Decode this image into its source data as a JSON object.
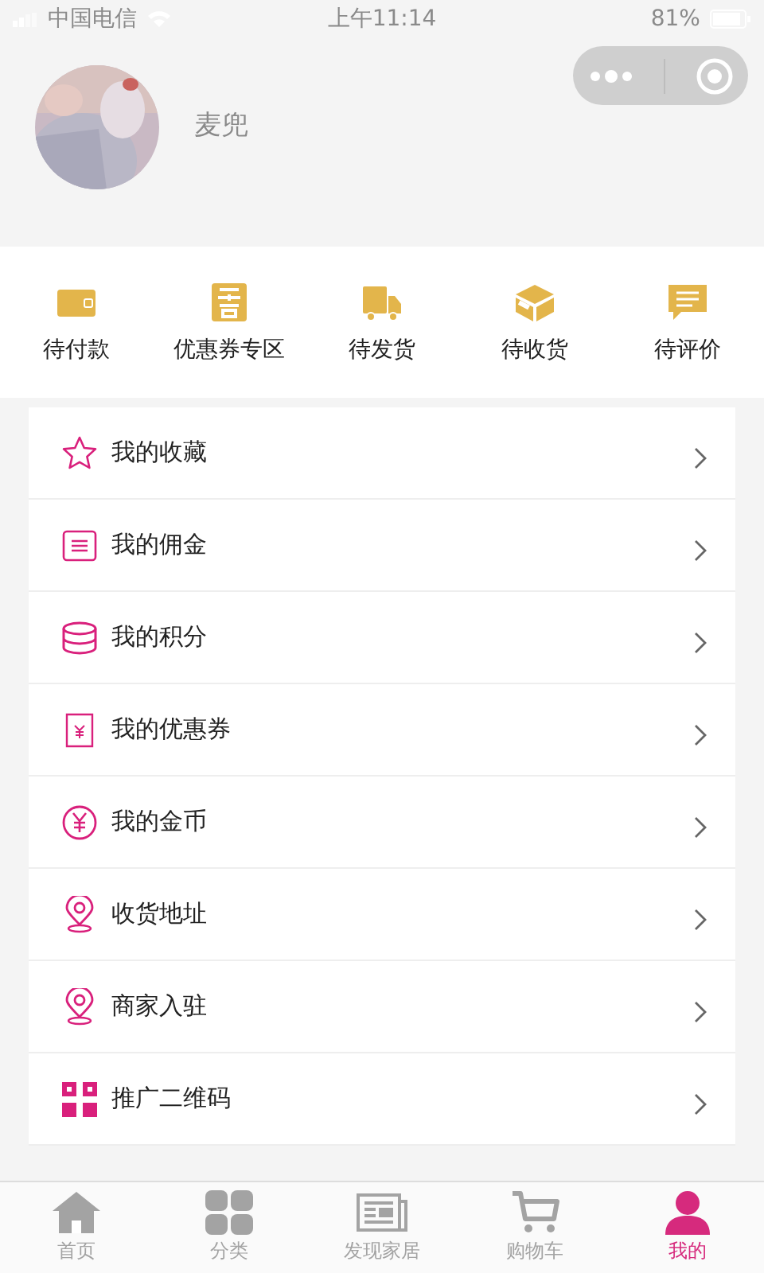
{
  "status_bar": {
    "carrier": "中国电信",
    "time": "上午11:14",
    "battery": "81%"
  },
  "profile": {
    "name": "麦兜"
  },
  "orders": [
    {
      "label": "待付款",
      "kind": "wallet"
    },
    {
      "label": "优惠券专区",
      "kind": "coupon"
    },
    {
      "label": "待发货",
      "kind": "truck"
    },
    {
      "label": "待收货",
      "kind": "box"
    },
    {
      "label": "待评价",
      "kind": "comment"
    }
  ],
  "menu": [
    {
      "label": "我的收藏",
      "kind": "star"
    },
    {
      "label": "我的佣金",
      "kind": "list"
    },
    {
      "label": "我的积分",
      "kind": "coins"
    },
    {
      "label": "我的优惠券",
      "kind": "ticket"
    },
    {
      "label": "我的金币",
      "kind": "yen"
    },
    {
      "label": "收货地址",
      "kind": "pin"
    },
    {
      "label": "商家入驻",
      "kind": "pin"
    },
    {
      "label": "推广二维码",
      "kind": "qr"
    }
  ],
  "tabs": [
    {
      "label": "首页",
      "kind": "home",
      "selected": false
    },
    {
      "label": "分类",
      "kind": "grid",
      "selected": false
    },
    {
      "label": "发现家居",
      "kind": "news",
      "selected": false
    },
    {
      "label": "购物车",
      "kind": "cart",
      "selected": false
    },
    {
      "label": "我的",
      "kind": "user",
      "selected": true
    }
  ]
}
